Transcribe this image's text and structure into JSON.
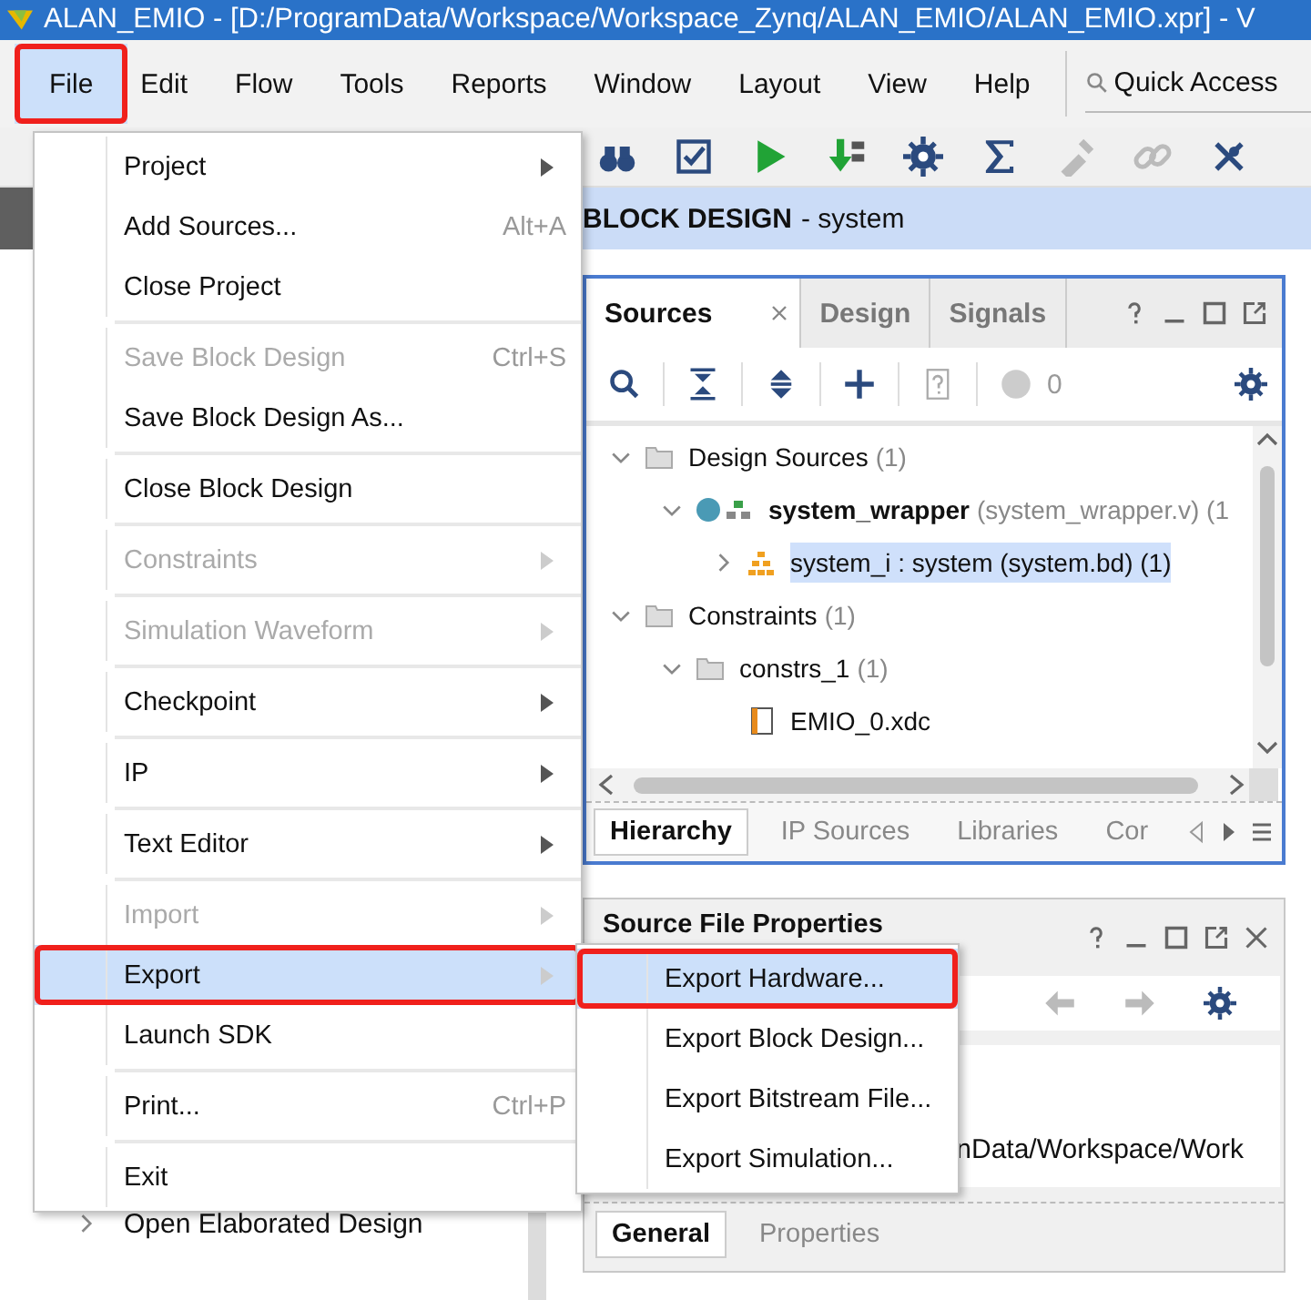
{
  "window": {
    "title": "ALAN_EMIO - [D:/ProgramData/Workspace/Workspace_Zynq/ALAN_EMIO/ALAN_EMIO.xpr] - V"
  },
  "menubar": [
    {
      "label": "File",
      "selected": true,
      "highlighted": true
    },
    {
      "label": "Edit",
      "selected": false,
      "highlighted": false
    },
    {
      "label": "Flow",
      "selected": false,
      "highlighted": false
    },
    {
      "label": "Tools",
      "selected": false,
      "highlighted": false
    },
    {
      "label": "Reports",
      "selected": false,
      "highlighted": false
    },
    {
      "label": "Window",
      "selected": false,
      "highlighted": false
    },
    {
      "label": "Layout",
      "selected": false,
      "highlighted": false
    },
    {
      "label": "View",
      "selected": false,
      "highlighted": false
    },
    {
      "label": "Help",
      "selected": false,
      "highlighted": false
    }
  ],
  "quick_access": {
    "placeholder": "Quick Access"
  },
  "toolbar": [
    {
      "kind": "binoculars",
      "disabled": false
    },
    {
      "kind": "checkbox",
      "disabled": false
    },
    {
      "kind": "run",
      "disabled": false
    },
    {
      "kind": "program",
      "disabled": false
    },
    {
      "kind": "gear",
      "disabled": false
    },
    {
      "kind": "sigma",
      "disabled": false
    },
    {
      "kind": "probe",
      "disabled": true
    },
    {
      "kind": "link",
      "disabled": true
    },
    {
      "kind": "cross_tool",
      "disabled": false
    }
  ],
  "editor_header": {
    "title": "BLOCK DESIGN",
    "subtitle": "- system"
  },
  "flow_navigator": {
    "items": [
      {
        "label": "Open Elaborated Design",
        "expanded": false
      }
    ]
  },
  "sources_panel": {
    "tabs": [
      {
        "label": "Sources",
        "selected": true,
        "closable": true
      },
      {
        "label": "Design",
        "selected": false,
        "closable": false
      },
      {
        "label": "Signals",
        "selected": false,
        "closable": false
      }
    ],
    "error_count": "0",
    "tree": [
      {
        "label": "Design Sources",
        "note": "(1)",
        "kind": "folder",
        "expanded": true,
        "selected": false,
        "children": [
          {
            "label": "system_wrapper",
            "note": "(system_wrapper.v) (1",
            "kind": "module",
            "top": true,
            "expanded": true,
            "selected": false,
            "children": [
              {
                "label": "system_i : system (system.bd) (1)",
                "kind": "block_design",
                "expanded": false,
                "selected": true
              }
            ]
          }
        ]
      },
      {
        "label": "Constraints",
        "note": "(1)",
        "kind": "folder",
        "expanded": true,
        "selected": false,
        "children": [
          {
            "label": "constrs_1",
            "note": "(1)",
            "kind": "folder",
            "expanded": true,
            "selected": false,
            "children": [
              {
                "label": "EMIO_0.xdc",
                "kind": "constraint_file",
                "selected": false
              }
            ]
          }
        ]
      }
    ],
    "bottom_tabs": [
      {
        "label": "Hierarchy",
        "selected": true
      },
      {
        "label": "IP Sources",
        "selected": false
      },
      {
        "label": "Libraries",
        "selected": false
      },
      {
        "label": "Cor",
        "selected": false
      }
    ]
  },
  "properties_panel": {
    "title": "Source File Properties",
    "path_fragment": "nData/Workspace/Work",
    "tabs": [
      {
        "label": "General",
        "selected": true
      },
      {
        "label": "Properties",
        "selected": false
      }
    ]
  },
  "file_menu": {
    "items": [
      {
        "kind": "item",
        "label": "Project",
        "submenu": true,
        "disabled": false,
        "selected": false,
        "highlighted": false
      },
      {
        "kind": "item",
        "label": "Add Sources...",
        "shortcut": "Alt+A",
        "submenu": false,
        "disabled": false,
        "selected": false,
        "highlighted": false
      },
      {
        "kind": "item",
        "label": "Close Project",
        "submenu": false,
        "disabled": false,
        "selected": false,
        "highlighted": false
      },
      {
        "kind": "separator"
      },
      {
        "kind": "item",
        "label": "Save Block Design",
        "shortcut": "Ctrl+S",
        "submenu": false,
        "disabled": true,
        "selected": false,
        "highlighted": false
      },
      {
        "kind": "item",
        "label": "Save Block Design As...",
        "submenu": false,
        "disabled": false,
        "selected": false,
        "highlighted": false
      },
      {
        "kind": "separator"
      },
      {
        "kind": "item",
        "label": "Close Block Design",
        "submenu": false,
        "disabled": false,
        "selected": false,
        "highlighted": false
      },
      {
        "kind": "separator"
      },
      {
        "kind": "item",
        "label": "Constraints",
        "submenu": true,
        "disabled": true,
        "selected": false,
        "highlighted": false
      },
      {
        "kind": "separator"
      },
      {
        "kind": "item",
        "label": "Simulation Waveform",
        "submenu": true,
        "disabled": true,
        "selected": false,
        "highlighted": false
      },
      {
        "kind": "separator"
      },
      {
        "kind": "item",
        "label": "Checkpoint",
        "submenu": true,
        "disabled": false,
        "selected": false,
        "highlighted": false
      },
      {
        "kind": "separator"
      },
      {
        "kind": "item",
        "label": "IP",
        "submenu": true,
        "disabled": false,
        "selected": false,
        "highlighted": false
      },
      {
        "kind": "separator"
      },
      {
        "kind": "item",
        "label": "Text Editor",
        "submenu": true,
        "disabled": false,
        "selected": false,
        "highlighted": false
      },
      {
        "kind": "separator"
      },
      {
        "kind": "item",
        "label": "Import",
        "submenu": true,
        "disabled": true,
        "selected": false,
        "highlighted": false
      },
      {
        "kind": "item",
        "label": "Export",
        "submenu": true,
        "disabled": false,
        "selected": true,
        "highlighted": true
      },
      {
        "kind": "item",
        "label": "Launch SDK",
        "submenu": false,
        "disabled": false,
        "selected": false,
        "highlighted": false
      },
      {
        "kind": "separator"
      },
      {
        "kind": "item",
        "label": "Print...",
        "shortcut": "Ctrl+P",
        "submenu": false,
        "disabled": false,
        "selected": false,
        "highlighted": false
      },
      {
        "kind": "separator"
      },
      {
        "kind": "item",
        "label": "Exit",
        "submenu": false,
        "disabled": false,
        "selected": false,
        "highlighted": false
      }
    ]
  },
  "export_submenu": {
    "items": [
      {
        "kind": "item",
        "label": "Export Hardware...",
        "submenu": false,
        "disabled": false,
        "selected": true,
        "highlighted": true
      },
      {
        "kind": "item",
        "label": "Export Block Design...",
        "submenu": false,
        "disabled": false,
        "selected": false,
        "highlighted": false
      },
      {
        "kind": "item",
        "label": "Export Bitstream File...",
        "submenu": false,
        "disabled": false,
        "selected": false,
        "highlighted": false
      },
      {
        "kind": "item",
        "label": "Export Simulation...",
        "submenu": false,
        "disabled": false,
        "selected": false,
        "highlighted": false
      }
    ]
  }
}
